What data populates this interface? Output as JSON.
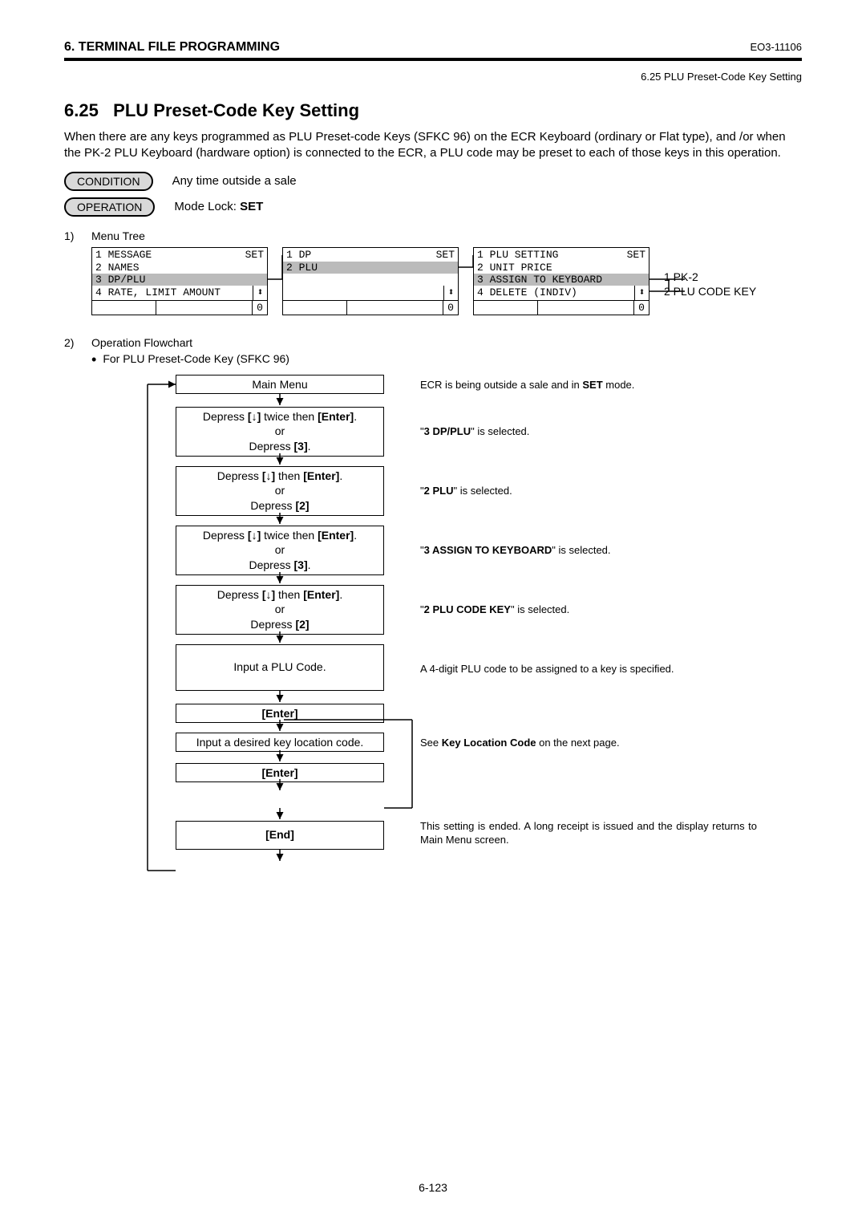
{
  "header": {
    "chapter": "6. TERMINAL FILE PROGRAMMING",
    "docid": "EO3-11106",
    "sub": "6.25 PLU Preset-Code Key Setting"
  },
  "section": {
    "number": "6.25",
    "title": "PLU Preset-Code Key Setting",
    "intro": "When there are any keys programmed as PLU Preset-code Keys (SFKC 96) on the ECR Keyboard (ordinary or Flat type), and /or when the PK-2 PLU Keyboard (hardware option) is connected to the ECR, a PLU code may be preset to each of those keys in this operation."
  },
  "condition": {
    "pill": "CONDITION",
    "text": "Any time outside a sale"
  },
  "operation": {
    "pill": "OPERATION",
    "text_prefix": "Mode Lock: ",
    "text_bold": "SET"
  },
  "item1": {
    "num": "1)",
    "title": "Menu Tree"
  },
  "menutree": {
    "set": "SET",
    "updown": "⬍",
    "zero": "0",
    "box1": {
      "r1": "1 MESSAGE",
      "r2": "2 NAMES",
      "r3": "3 DP/PLU",
      "r4": "4 RATE, LIMIT AMOUNT"
    },
    "box2": {
      "r1": "1 DP",
      "r2": "2 PLU"
    },
    "box3": {
      "r1": "1 PLU SETTING",
      "r2": "2 UNIT PRICE",
      "r3": "3 ASSIGN TO KEYBOARD",
      "r4": "4 DELETE (INDIV)"
    },
    "labels": {
      "l1": "1 PK-2",
      "l2": "2 PLU CODE KEY"
    }
  },
  "item2": {
    "num": "2)",
    "title": "Operation Flowchart",
    "bullet_text": "For PLU Preset-Code Key (SFKC 96)"
  },
  "flow": {
    "b1": "Main Menu",
    "b2_l1a": "Depress ",
    "b2_l1b": "[↓]",
    "b2_l1c": " twice then ",
    "b2_l1d": "[Enter]",
    "b2_l1e": ".",
    "b2_l2": "or",
    "b2_l3a": "Depress ",
    "b2_l3b": "[3]",
    "b2_l3c": ".",
    "b3_l1a": "Depress ",
    "b3_l1b": "[↓]",
    "b3_l1c": " then ",
    "b3_l1d": "[Enter]",
    "b3_l1e": ".",
    "b3_l2": "or",
    "b3_l3a": "Depress ",
    "b3_l3b": "[2]",
    "b4_l1a": "Depress ",
    "b4_l1b": "[↓]",
    "b4_l1c": " twice then ",
    "b4_l1d": "[Enter]",
    "b4_l1e": ".",
    "b4_l2": "or",
    "b4_l3a": "Depress ",
    "b4_l3b": "[3]",
    "b4_l3c": ".",
    "b5_l1a": "Depress ",
    "b5_l1b": "[↓]",
    "b5_l1c": " then ",
    "b5_l1d": "[Enter]",
    "b5_l1e": ".",
    "b5_l2": "or",
    "b5_l3a": "Depress ",
    "b5_l3b": "[2]",
    "b6": "Input a PLU Code.",
    "b7": "[Enter]",
    "b8": "Input a desired key location code.",
    "b9": "[Enter]",
    "b10": "[End]"
  },
  "desc": {
    "d1_a": "ECR is being outside a sale and in ",
    "d1_b": "SET",
    "d1_c": " mode.",
    "d2_a": "\"",
    "d2_b": "3 DP/PLU",
    "d2_c": "\" is selected.",
    "d3_a": "\"",
    "d3_b": "2 PLU",
    "d3_c": "\" is selected.",
    "d4_a": "\"",
    "d4_b": "3 ASSIGN TO KEYBOARD",
    "d4_c": "\" is selected.",
    "d5_a": "\"",
    "d5_b": "2 PLU CODE KEY",
    "d5_c": "\" is selected.",
    "d6": "A 4-digit PLU code to be assigned to a key is specified.",
    "d7_a": "See ",
    "d7_b": "Key Location Code",
    "d7_c": " on the next page.",
    "d8": "This setting is ended.  A long receipt is issued and the display returns to Main Menu screen."
  },
  "pagenum": "6-123"
}
